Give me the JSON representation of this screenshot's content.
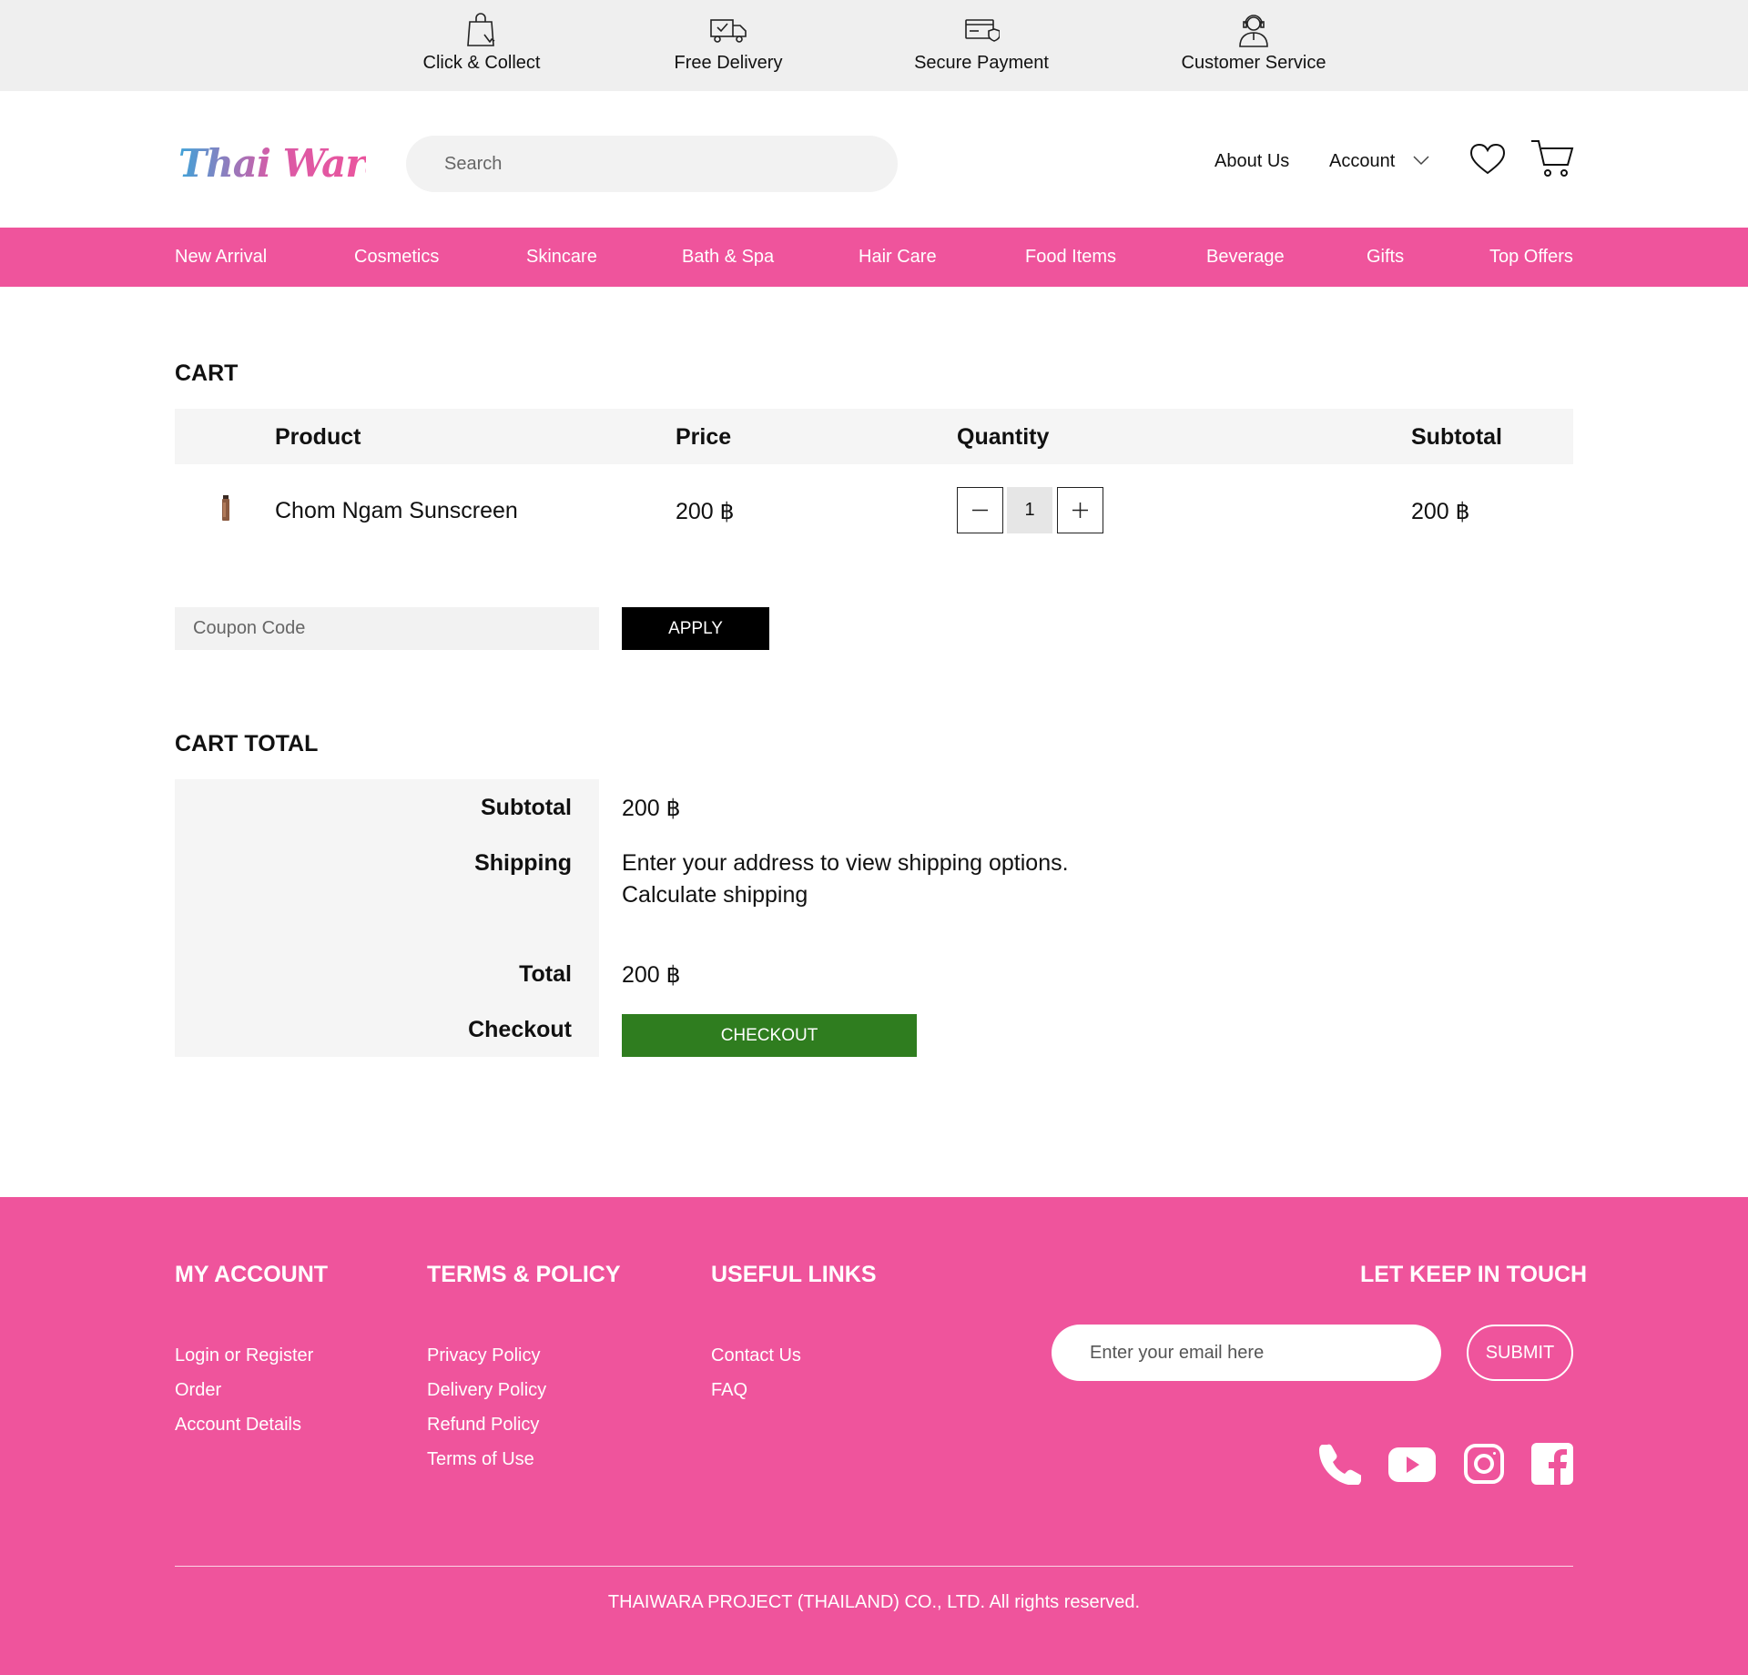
{
  "colors": {
    "brand_pink": "#ef549c",
    "checkout_green": "#2f7d1f",
    "apply_black": "#000000",
    "light_gray": "#f5f5f5"
  },
  "service_bar": [
    {
      "icon": "shopping-bag-icon",
      "label": "Click & Collect"
    },
    {
      "icon": "delivery-truck-icon",
      "label": "Free Delivery"
    },
    {
      "icon": "credit-card-shield-icon",
      "label": "Secure Payment"
    },
    {
      "icon": "support-agent-icon",
      "label": "Customer Service"
    }
  ],
  "header": {
    "logo_text": "Thai Wara",
    "search_placeholder": "Search",
    "about_label": "About Us",
    "account_label": "Account"
  },
  "categories": [
    "New Arrival",
    "Cosmetics",
    "Skincare",
    "Bath & Spa",
    "Hair Care",
    "Food Items",
    "Beverage",
    "Gifts",
    "Top Offers"
  ],
  "cart": {
    "title": "CART",
    "columns": {
      "product": "Product",
      "price": "Price",
      "quantity": "Quantity",
      "subtotal": "Subtotal"
    },
    "items": [
      {
        "name": "Chom Ngam Sunscreen",
        "price": "200 ฿",
        "quantity": "1",
        "subtotal": "200 ฿"
      }
    ],
    "coupon_placeholder": "Coupon Code",
    "apply_label": "APPLY"
  },
  "cart_total": {
    "title": "CART TOTAL",
    "subtotal_label": "Subtotal",
    "subtotal_value": "200 ฿",
    "shipping_label": "Shipping",
    "shipping_text": "Enter your address to view shipping options.",
    "shipping_link": "Calculate shipping",
    "total_label": "Total",
    "total_value": "200 ฿",
    "checkout_label": "Checkout",
    "checkout_button": "CHECKOUT"
  },
  "footer": {
    "my_account": {
      "heading": "MY ACCOUNT",
      "links": [
        "Login or Register",
        "Order",
        "Account Details"
      ]
    },
    "terms": {
      "heading": "TERMS & POLICY",
      "links": [
        "Privacy Policy",
        "Delivery Policy",
        "Refund Policy",
        "Terms of Use"
      ]
    },
    "useful": {
      "heading": "USEFUL LINKS",
      "links": [
        "Contact Us",
        "FAQ"
      ]
    },
    "keep_in_touch": "LET KEEP IN TOUCH",
    "email_placeholder": "Enter your email here",
    "submit_label": "SUBMIT",
    "social_icons": [
      "phone-icon",
      "youtube-icon",
      "instagram-icon",
      "facebook-icon"
    ],
    "copyright": "THAIWARA PROJECT (THAILAND) CO., LTD. All rights reserved."
  }
}
